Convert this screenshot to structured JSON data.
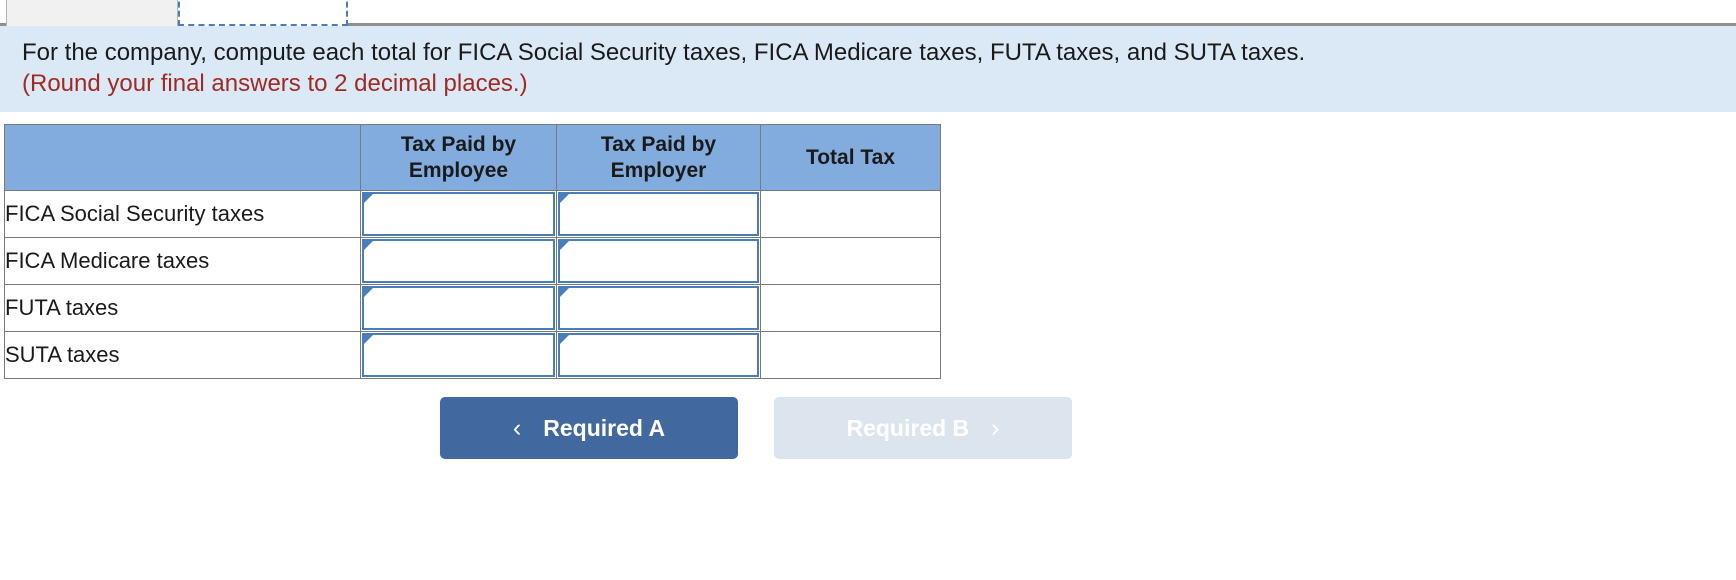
{
  "tabs": [
    {
      "label": "",
      "state": "inactive",
      "name": "tab-required-a"
    },
    {
      "label": "",
      "state": "active-dashed",
      "name": "tab-required-b"
    }
  ],
  "instruction": {
    "line1": "For the company, compute each total for FICA Social Security taxes, FICA Medicare taxes, FUTA taxes, and SUTA taxes.",
    "line2": "(Round your final answers to 2 decimal places.)"
  },
  "table": {
    "columns": [
      {
        "key": "label",
        "header": ""
      },
      {
        "key": "employee",
        "header": "Tax Paid by Employee"
      },
      {
        "key": "employer",
        "header": "Tax Paid by Employer"
      },
      {
        "key": "total",
        "header": "Total Tax"
      }
    ],
    "rows": [
      {
        "label": "FICA Social Security taxes",
        "employee": "",
        "employer": "",
        "total": ""
      },
      {
        "label": "FICA Medicare taxes",
        "employee": "",
        "employer": "",
        "total": ""
      },
      {
        "label": "FUTA taxes",
        "employee": "",
        "employer": "",
        "total": ""
      },
      {
        "label": "SUTA taxes",
        "employee": "",
        "employer": "",
        "total": ""
      }
    ],
    "input_placeholder": ""
  },
  "navigation": {
    "prev": {
      "label": "Required A",
      "chevron": "‹",
      "state": "enabled"
    },
    "next": {
      "label": "Required B",
      "chevron": "›",
      "state": "disabled"
    }
  },
  "colors": {
    "banner_bg": "#dbe9f7",
    "banner_warning_text": "#9e2a22",
    "table_header_bg": "#82abde",
    "input_border": "#4a7ebb",
    "btn_primary_bg": "#41699f",
    "btn_disabled_bg": "#dce4ed",
    "table_border": "#7a7a7a"
  }
}
